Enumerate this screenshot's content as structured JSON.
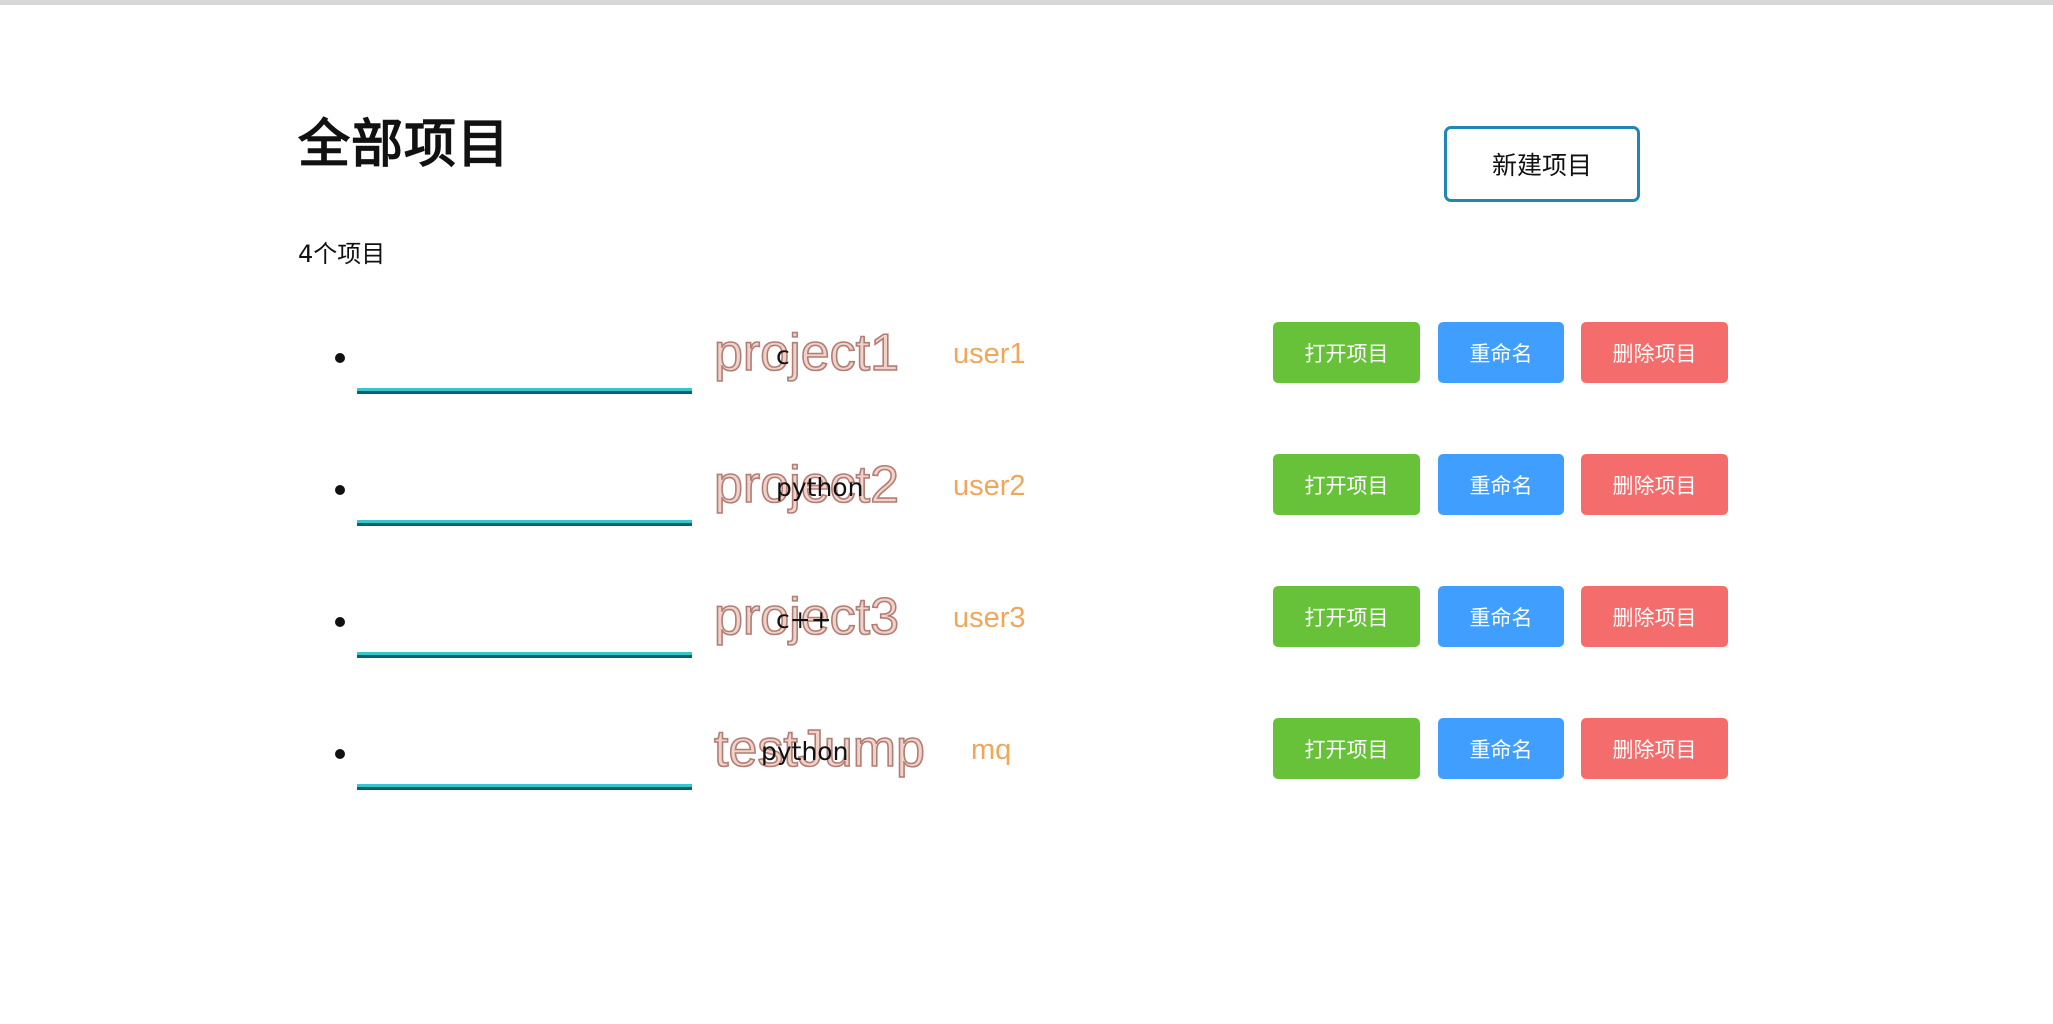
{
  "header": {
    "title": "全部项目",
    "new_project_label": "新建项目",
    "count_text": "4个项目"
  },
  "actions": {
    "open_label": "打开项目",
    "rename_label": "重命名",
    "delete_label": "删除项目"
  },
  "projects": [
    {
      "name": "project1",
      "user": "user1",
      "language": "c"
    },
    {
      "name": "project2",
      "user": "user2",
      "language": "python"
    },
    {
      "name": "project3",
      "user": "user3",
      "language": "c++"
    },
    {
      "name": "testJump",
      "user": "mq",
      "language": "python"
    }
  ],
  "colors": {
    "open_button": "#67c23a",
    "rename_button": "#409eff",
    "delete_button": "#f56c6c",
    "user_text": "#f2a65a",
    "new_project_border": "#1f86b5"
  }
}
